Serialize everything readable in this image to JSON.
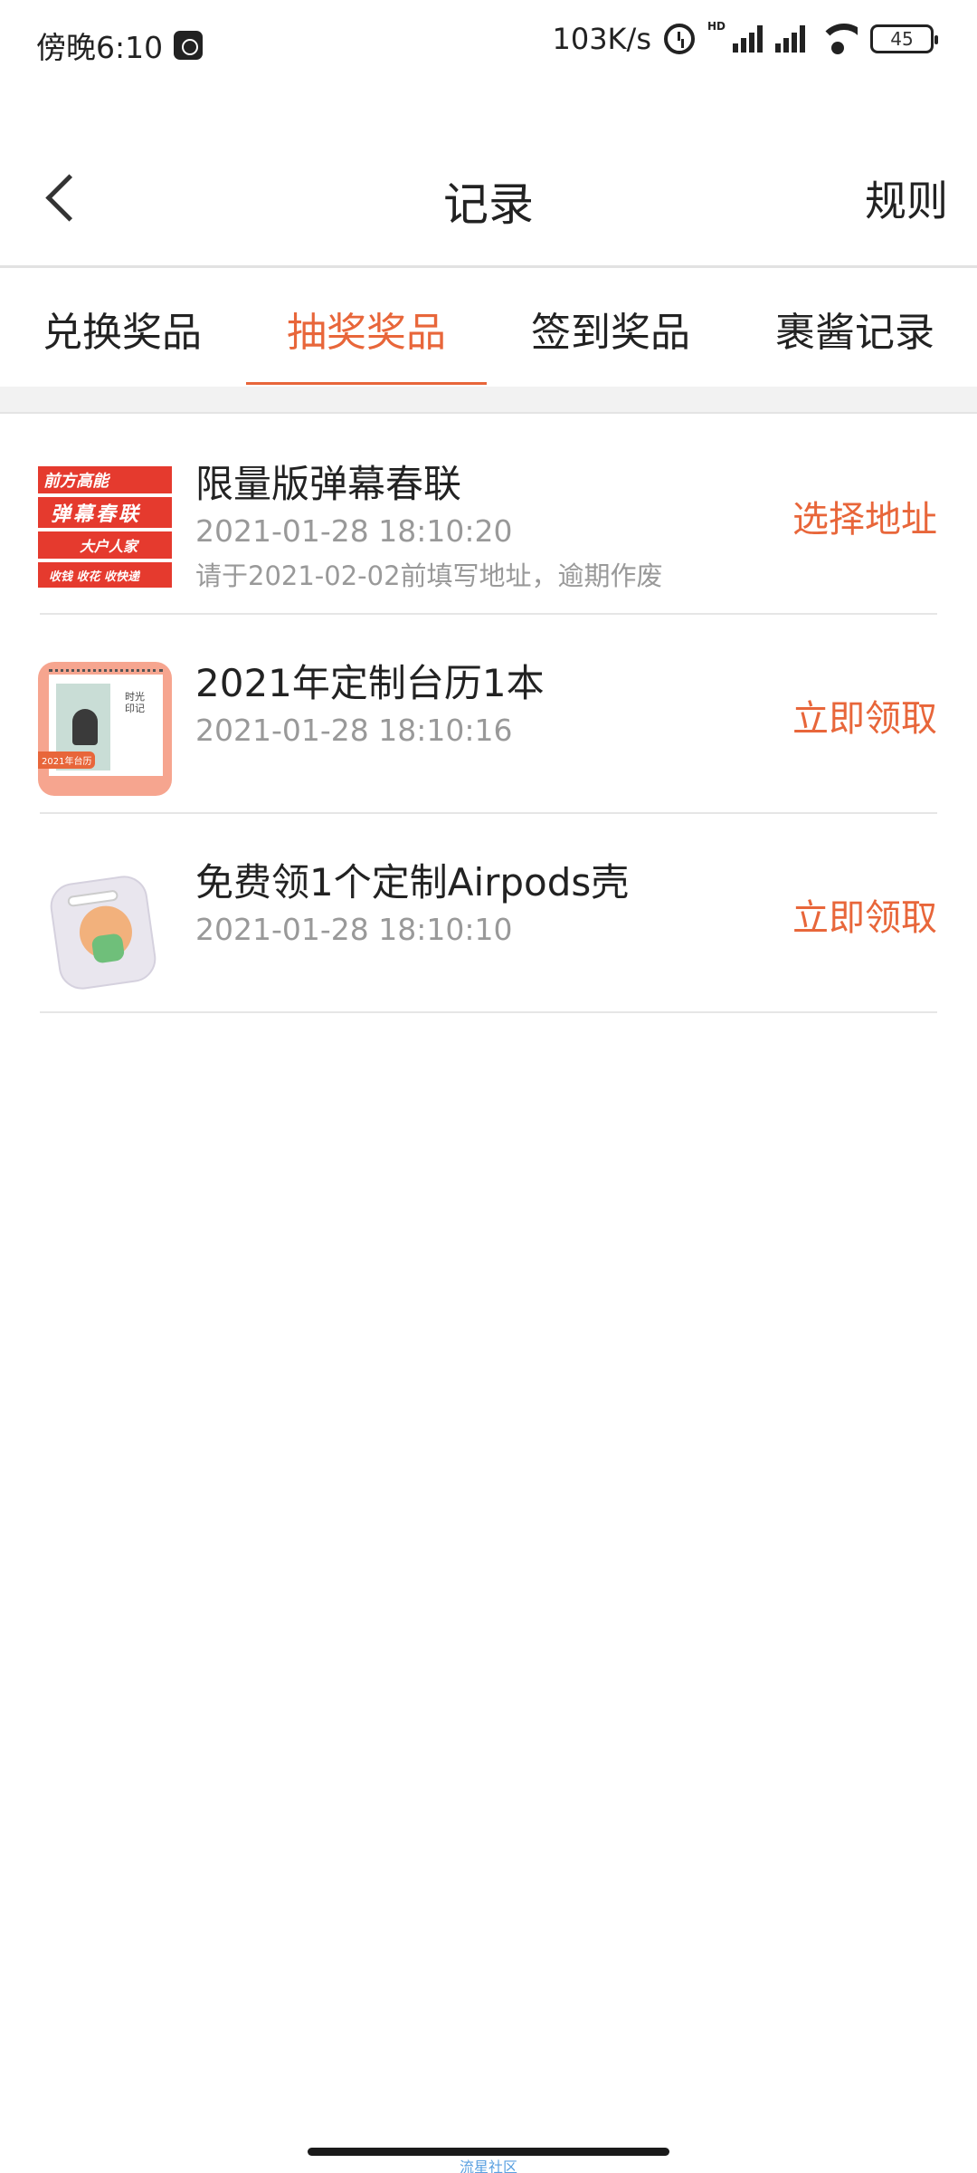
{
  "status_bar": {
    "time": "傍晚6:10",
    "net_speed": "103K/s",
    "hd": "HD",
    "battery": "45",
    "icons": [
      "message-icon",
      "alarm-icon",
      "signal-hd-icon",
      "signal-icon",
      "wifi-icon",
      "battery-icon"
    ]
  },
  "header": {
    "title": "记录",
    "rule_label": "规则",
    "back_icon": "chevron-left-icon"
  },
  "tabs": [
    {
      "label": "兑换奖品",
      "active": false
    },
    {
      "label": "抽奖奖品",
      "active": true
    },
    {
      "label": "签到奖品",
      "active": false
    },
    {
      "label": "裹酱记录",
      "active": false
    }
  ],
  "records": [
    {
      "title": "限量版弹幕春联",
      "time": "2021-01-28 18:10:20",
      "note": "请于2021-02-02前填写地址，逾期作废",
      "action": "选择地址",
      "thumb_lines": [
        "前方高能",
        "弹幕春联",
        "大户人家",
        "收钱 收花 收快递"
      ]
    },
    {
      "title": "2021年定制台历1本",
      "time": "2021-01-28 18:10:16",
      "note": "",
      "action": "立即领取",
      "thumb_text": "时光印记",
      "thumb_tag": "2021年台历"
    },
    {
      "title": "免费领1个定制Airpods壳",
      "time": "2021-01-28 18:10:10",
      "note": "",
      "action": "立即领取"
    }
  ],
  "footer": {
    "watermark": "流星社区"
  },
  "colors": {
    "accent": "#e8663a",
    "text_primary": "#222222",
    "text_secondary": "#999999",
    "divider": "#e6e6e6",
    "band": "#f2f2f2"
  }
}
